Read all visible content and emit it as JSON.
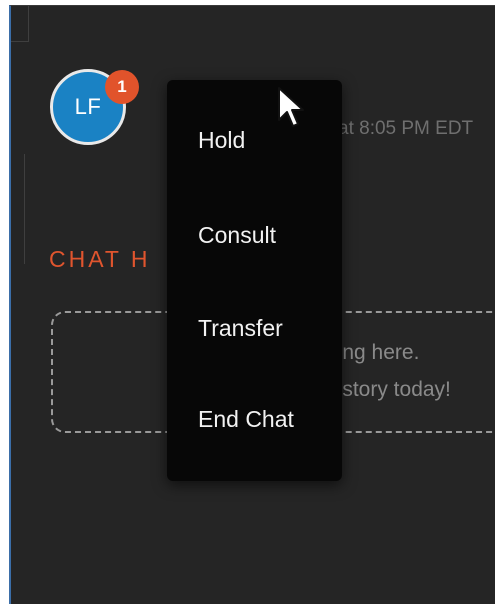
{
  "avatar": {
    "initials": "LF",
    "badge_count": "1",
    "color": "#1a82c4",
    "badge_color": "#e1532b"
  },
  "chat_meta": {
    "timestamp_partial": "at 8:05 PM EDT"
  },
  "chat_history": {
    "title_partial": "CHAT H",
    "empty_line_1_partial": "hing here.",
    "empty_line_2_partial": "history today!",
    "title_color": "#e0552e"
  },
  "context_menu": {
    "items": [
      {
        "label": "Hold"
      },
      {
        "label": "Consult"
      },
      {
        "label": "Transfer"
      },
      {
        "label": "End Chat"
      }
    ]
  },
  "cursor": {
    "icon": "mouse-pointer-icon"
  }
}
